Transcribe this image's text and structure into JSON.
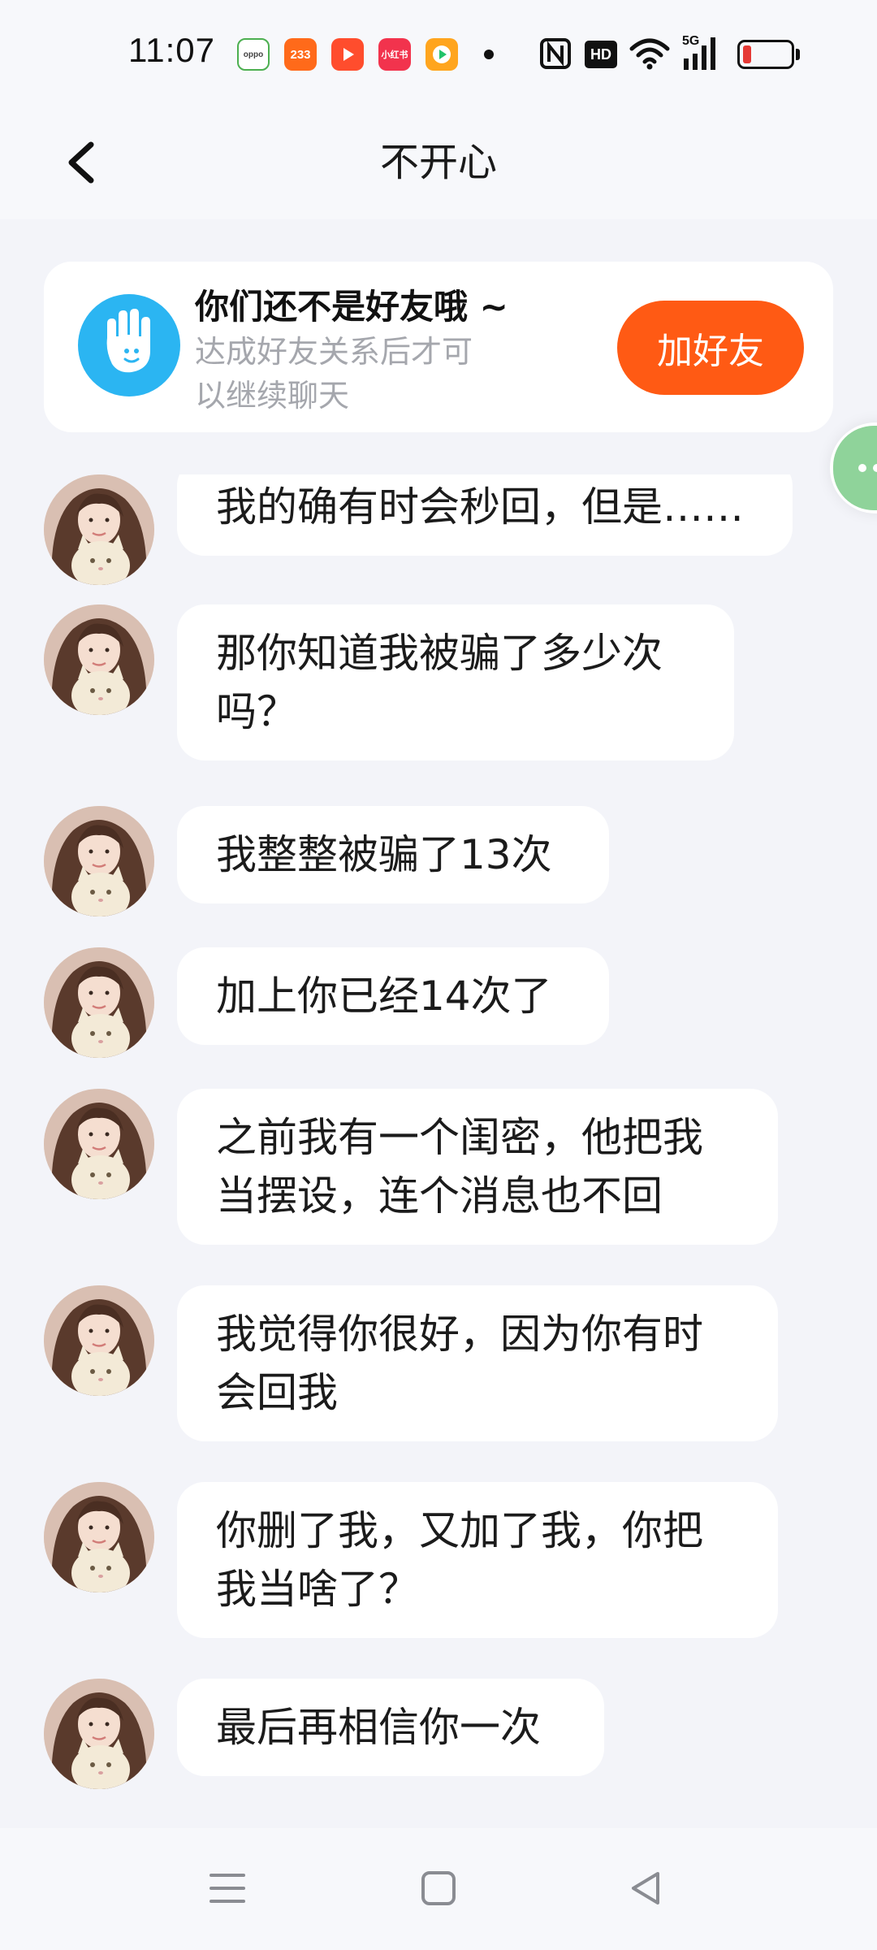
{
  "status_bar": {
    "time": "11:07",
    "apps": [
      {
        "name": "oppo-app-icon",
        "label": "oppo",
        "color": "#4caf50"
      },
      {
        "name": "app-233-icon",
        "label": "233",
        "color": "#ff6a1a"
      },
      {
        "name": "video-play-icon",
        "label": "",
        "color": "#ff4d2d"
      },
      {
        "name": "xiaohongshu-icon",
        "label": "小红书",
        "color": "#f2334d"
      },
      {
        "name": "media-app-icon",
        "label": "",
        "color": "#ffa51e"
      }
    ],
    "icons": [
      "nfc-icon",
      "hd-icon",
      "wifi-icon",
      "signal-5g-icon",
      "battery-icon"
    ],
    "network_label": "5G",
    "hd_label": "HD"
  },
  "header": {
    "title": "不开心",
    "back_icon": "chevron-left-icon"
  },
  "banner": {
    "title": "你们还不是好友哦 ~",
    "description": "达成好友关系后才可以继续聊天",
    "button_label": "加好友",
    "accent": "#ff5a14",
    "icon": "hand-wave-icon",
    "icon_color": "#2bb5f2"
  },
  "messages": [
    {
      "text": "我的确有时会秒回，但是……"
    },
    {
      "text": "那你知道我被骗了多少次\n吗？"
    },
    {
      "text": "我整整被骗了13次"
    },
    {
      "text": "加上你已经14次了"
    },
    {
      "text": "之前我有一个闺密，他把我\n当摆设，连个消息也不回"
    },
    {
      "text": "我觉得你很好，因为你有时\n会回我"
    },
    {
      "text": "你删了我，又加了我，你把\n我当啥了？"
    },
    {
      "text": "最后再相信你一次"
    }
  ],
  "nav": {
    "buttons": [
      "menu-icon",
      "home-square-icon",
      "back-triangle-icon"
    ]
  },
  "colors": {
    "background": "#f3f4f9",
    "bubble": "#ffffff",
    "side_handle": "#8fd39a"
  }
}
